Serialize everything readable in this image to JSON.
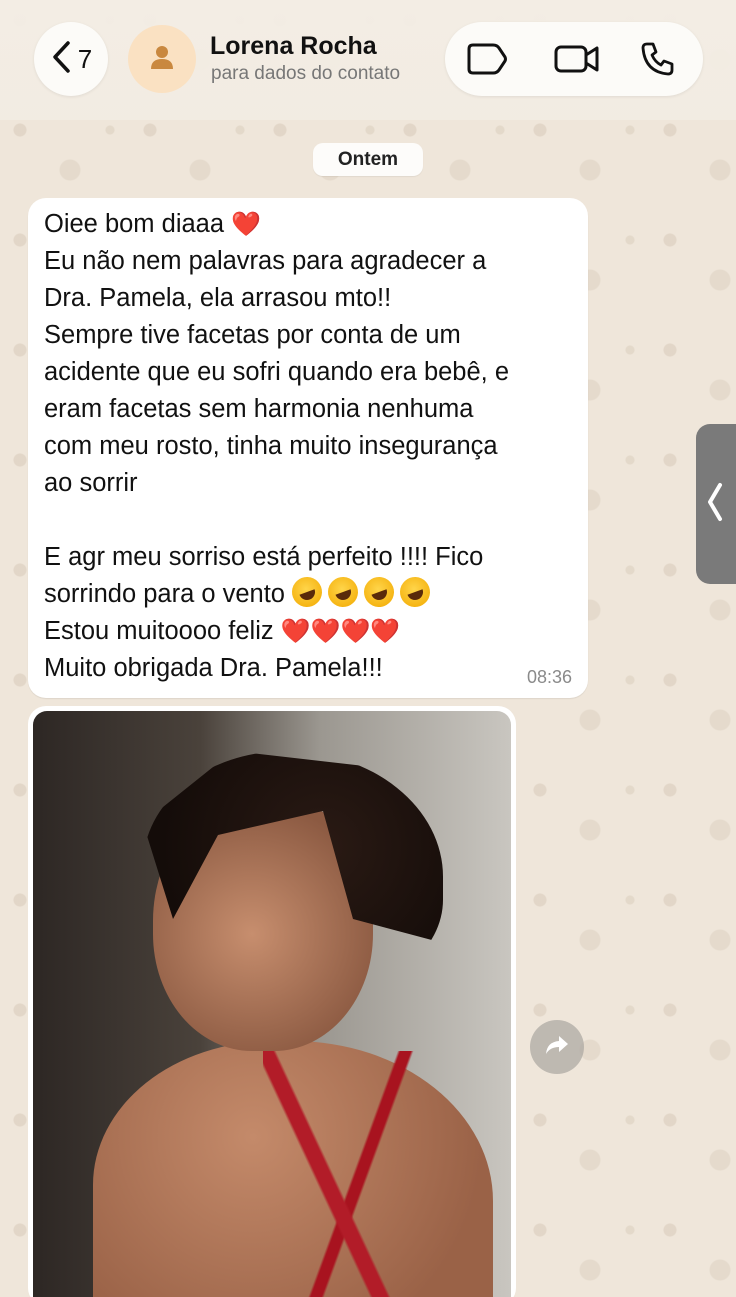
{
  "header": {
    "back_count": "7",
    "contact_name": "Lorena Rocha",
    "contact_subtitle": "para dados do contato",
    "icons": {
      "back": "chevron-left-icon",
      "avatar": "person-icon",
      "label": "tag-icon",
      "video": "video-camera-icon",
      "phone": "phone-icon"
    }
  },
  "chat": {
    "date_separator": "Ontem",
    "message": {
      "lines": [
        "Oiee bom diaaa",
        "Eu não nem palavras para agradecer a",
        "Dra. Pamela, ela arrasou mto!!",
        "Sempre tive facetas por conta de um",
        "acidente que eu sofri quando era bebê, e",
        "eram facetas sem harmonia nenhuma",
        "com meu rosto, tinha muito insegurança",
        "ao sorrir",
        "",
        "E agr meu sorriso está perfeito !!!! Fico",
        "sorrindo para o vento",
        "Estou muitoooo feliz",
        "Muito obrigada Dra. Pamela!!!"
      ],
      "time": "08:36"
    },
    "photo_message": {
      "icons": {
        "share": "forward-arrow-icon"
      }
    }
  },
  "side_tab": {
    "icon": "chevron-left-icon"
  },
  "colors": {
    "chat_background": "#efe6da",
    "bubble": "#ffffff",
    "avatar_bg": "#fae1c2",
    "avatar_fg": "#c9883f",
    "heart": "#e0232e"
  }
}
